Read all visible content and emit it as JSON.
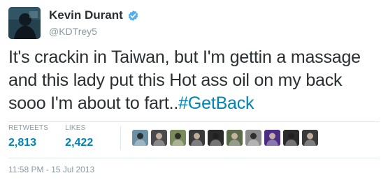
{
  "user": {
    "display_name": "Kevin Durant",
    "handle": "@KDTrey5",
    "verified": true
  },
  "tweet": {
    "text": "It's crackin in Taiwan, but I'm gettin a massage and this lady put this Hot ass oil on my back sooo I'm about to fart..",
    "hashtag": "#GetBack",
    "timestamp": "11:58 PM - 15 Jul 2013"
  },
  "stats": {
    "retweets_label": "RETWEETS",
    "retweets_count": "2,813",
    "likes_label": "LIKES",
    "likes_count": "2,422"
  },
  "likers": [
    {
      "name": "liker-avatar-1",
      "color": "#6b8fa3"
    },
    {
      "name": "liker-avatar-2",
      "color": "#4a4a4a"
    },
    {
      "name": "liker-avatar-3",
      "color": "#7a8a5a"
    },
    {
      "name": "liker-avatar-4",
      "color": "#3a3a3a"
    },
    {
      "name": "liker-avatar-5",
      "color": "#2a2a2a"
    },
    {
      "name": "liker-avatar-6",
      "color": "#5a6a4a"
    },
    {
      "name": "liker-avatar-7",
      "color": "#8a8a8a"
    },
    {
      "name": "liker-avatar-8",
      "color": "#4b2e83"
    },
    {
      "name": "liker-avatar-9",
      "color": "#2a2a2a"
    },
    {
      "name": "liker-avatar-10",
      "color": "#3a3a3a"
    }
  ],
  "colors": {
    "link": "#0084b4",
    "muted": "#8899a6",
    "text": "#292f33",
    "verified": "#55acee",
    "divider": "#e1e8ed"
  }
}
